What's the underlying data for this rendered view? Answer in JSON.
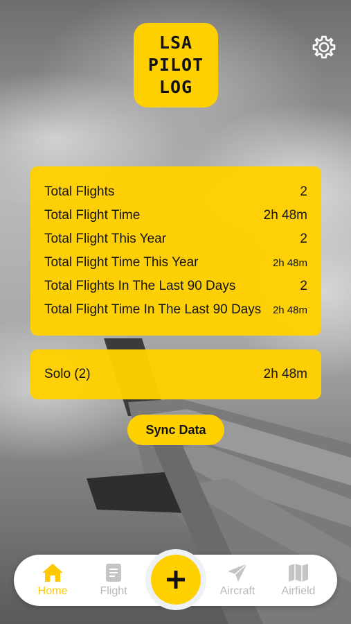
{
  "app": {
    "logo_lines": [
      "LSA",
      "PILOT",
      "LOG"
    ]
  },
  "stats": [
    {
      "label": "Total Flights",
      "value": "2"
    },
    {
      "label": "Total Flight Time",
      "value": "2h 48m"
    },
    {
      "label": "Total Flight This Year",
      "value": "2"
    },
    {
      "label": "Total Flight Time This Year",
      "value": "2h 48m"
    },
    {
      "label": "Total Flights In The Last 90 Days",
      "value": "2"
    },
    {
      "label": "Total Flight Time In The Last 90 Days",
      "value": "2h 48m"
    }
  ],
  "solo": {
    "label": "Solo (2)",
    "value": "2h 48m"
  },
  "sync_label": "Sync Data",
  "tabs": [
    {
      "label": "Home",
      "icon": "home-icon",
      "active": true
    },
    {
      "label": "Flight",
      "icon": "document-icon",
      "active": false
    },
    {
      "label": "Aircraft",
      "icon": "paper-plane-icon",
      "active": false
    },
    {
      "label": "Airfield",
      "icon": "map-icon",
      "active": false
    }
  ],
  "colors": {
    "accent": "#ffd000",
    "inactive_tab": "#b8b8b8",
    "active_tab": "#ffc800"
  }
}
